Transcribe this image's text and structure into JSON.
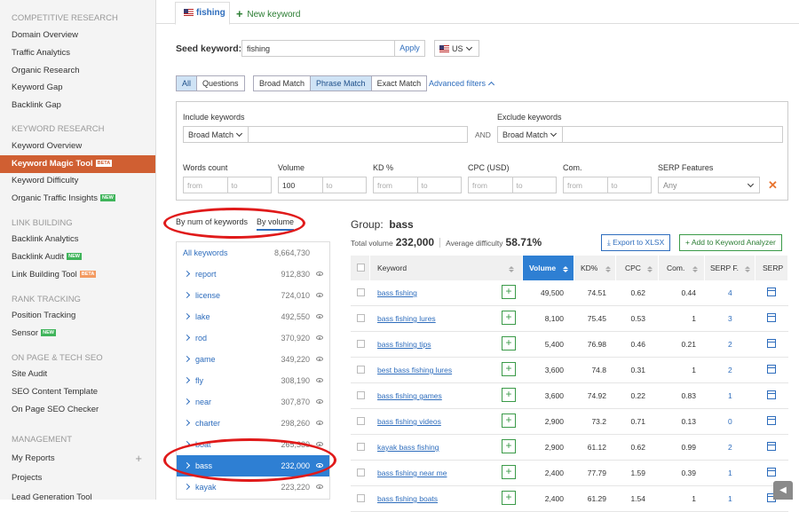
{
  "sidebar": {
    "sections": [
      {
        "title": "COMPETITIVE RESEARCH",
        "items": [
          {
            "label": "Domain Overview"
          },
          {
            "label": "Traffic Analytics"
          },
          {
            "label": "Organic Research"
          },
          {
            "label": "Keyword Gap"
          },
          {
            "label": "Backlink Gap"
          }
        ]
      },
      {
        "title": "KEYWORD RESEARCH",
        "items": [
          {
            "label": "Keyword Overview"
          },
          {
            "label": "Keyword Magic Tool",
            "badge": "BETA",
            "active": true
          },
          {
            "label": "Keyword Difficulty"
          },
          {
            "label": "Organic Traffic Insights",
            "badge": "NEW"
          }
        ]
      },
      {
        "title": "LINK BUILDING",
        "items": [
          {
            "label": "Backlink Analytics"
          },
          {
            "label": "Backlink Audit",
            "badge": "NEW"
          },
          {
            "label": "Link Building Tool",
            "badge": "BETA"
          }
        ]
      },
      {
        "title": "RANK TRACKING",
        "items": [
          {
            "label": "Position Tracking"
          },
          {
            "label": "Sensor",
            "badge": "NEW"
          }
        ]
      },
      {
        "title": "ON PAGE & TECH SEO",
        "items": [
          {
            "label": "Site Audit"
          },
          {
            "label": "SEO Content Template"
          },
          {
            "label": "On Page SEO Checker"
          }
        ]
      },
      {
        "title": "MANAGEMENT",
        "items": [
          {
            "label": "My Reports",
            "plus": "+"
          },
          {
            "label": "Projects"
          },
          {
            "label": "Lead Generation Tool"
          }
        ]
      }
    ]
  },
  "tabs": {
    "active": "fishing",
    "new": "New keyword"
  },
  "seed": {
    "label": "Seed keyword:",
    "value": "fishing",
    "apply": "Apply",
    "database": "US"
  },
  "match_tabs": {
    "group1": [
      "All",
      "Questions"
    ],
    "group2": [
      "Broad Match",
      "Phrase Match",
      "Exact Match"
    ],
    "selected": [
      "All",
      "Phrase Match"
    ],
    "advanced": "Advanced filters"
  },
  "filters": {
    "include_label": "Include keywords",
    "include_match": "Broad Match",
    "and": "AND",
    "exclude_label": "Exclude keywords",
    "exclude_match": "Broad Match",
    "words_label": "Words count",
    "volume_label": "Volume",
    "kd_label": "KD %",
    "cpc_label": "CPC (USD)",
    "com_label": "Com.",
    "serp_label": "SERP Features",
    "serp_value": "Any",
    "from": "from",
    "to": "to",
    "volume_from": "100"
  },
  "groups": {
    "tabs": [
      "By num of keywords",
      "By volume"
    ],
    "active_tab": "By volume",
    "all": {
      "name": "All keywords",
      "count": "8,664,730"
    },
    "items": [
      {
        "name": "report",
        "count": "912,830"
      },
      {
        "name": "license",
        "count": "724,010"
      },
      {
        "name": "lake",
        "count": "492,550"
      },
      {
        "name": "rod",
        "count": "370,920"
      },
      {
        "name": "game",
        "count": "349,220"
      },
      {
        "name": "fly",
        "count": "308,190"
      },
      {
        "name": "near",
        "count": "307,870"
      },
      {
        "name": "charter",
        "count": "298,260"
      },
      {
        "name": "boat",
        "count": "265,330"
      },
      {
        "name": "bass",
        "count": "232,000",
        "selected": true
      },
      {
        "name": "kayak",
        "count": "223,220"
      }
    ]
  },
  "group_detail": {
    "title_prefix": "Group:",
    "title": "bass",
    "total_volume_label": "Total volume",
    "total_volume": "232,000",
    "avg_difficulty_label": "Average difficulty",
    "avg_difficulty": "58.71%",
    "export": "Export to XLSX",
    "add_analyzer": "Add to Keyword Analyzer"
  },
  "table": {
    "columns": [
      "Keyword",
      "Volume",
      "KD%",
      "CPC",
      "Com.",
      "SERP F.",
      "SERP"
    ],
    "rows": [
      {
        "keyword": "bass fishing",
        "volume": "49,500",
        "kd": "74.51",
        "cpc": "0.62",
        "com": "0.44",
        "serp_f": "4"
      },
      {
        "keyword": "bass fishing lures",
        "volume": "8,100",
        "kd": "75.45",
        "cpc": "0.53",
        "com": "1",
        "serp_f": "3"
      },
      {
        "keyword": "bass fishing tips",
        "volume": "5,400",
        "kd": "76.98",
        "cpc": "0.46",
        "com": "0.21",
        "serp_f": "2"
      },
      {
        "keyword": "best bass fishing lures",
        "volume": "3,600",
        "kd": "74.8",
        "cpc": "0.31",
        "com": "1",
        "serp_f": "2"
      },
      {
        "keyword": "bass fishing games",
        "volume": "3,600",
        "kd": "74.92",
        "cpc": "0.22",
        "com": "0.83",
        "serp_f": "1"
      },
      {
        "keyword": "bass fishing videos",
        "volume": "2,900",
        "kd": "73.2",
        "cpc": "0.71",
        "com": "0.13",
        "serp_f": "0"
      },
      {
        "keyword": "kayak bass fishing",
        "volume": "2,900",
        "kd": "61.12",
        "cpc": "0.62",
        "com": "0.99",
        "serp_f": "2"
      },
      {
        "keyword": "bass fishing near me",
        "volume": "2,400",
        "kd": "77.79",
        "cpc": "1.59",
        "com": "0.39",
        "serp_f": "1"
      },
      {
        "keyword": "bass fishing boats",
        "volume": "2,400",
        "kd": "61.29",
        "cpc": "1.54",
        "com": "1",
        "serp_f": "1"
      }
    ]
  },
  "colors": {
    "accent": "#2e7fd3",
    "active_nav": "#d05f32",
    "annotation": "#e01a1a"
  }
}
